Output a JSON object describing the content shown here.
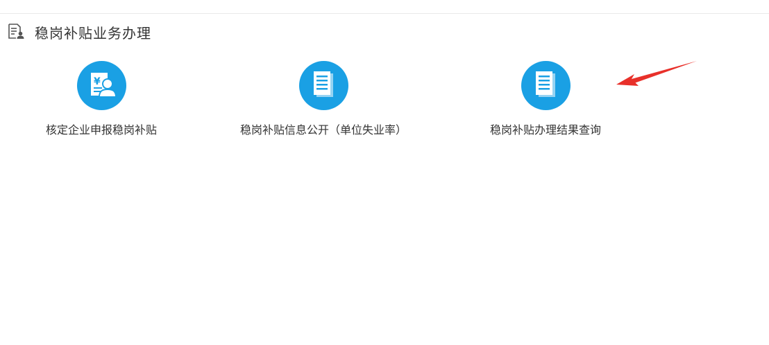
{
  "section": {
    "title": "稳岗补贴业务办理",
    "icon": "document-user-icon"
  },
  "services": [
    {
      "label": "核定企业申报稳岗补贴",
      "icon": "subsidy-applicant-icon"
    },
    {
      "label": "稳岗补贴信息公开（单位失业率）",
      "icon": "document-list-icon"
    },
    {
      "label": "稳岗补贴办理结果查询",
      "icon": "document-list-icon"
    }
  ],
  "colors": {
    "accent": "#1aa0e4",
    "annotation_arrow": "#e8302a",
    "text": "#333333"
  }
}
